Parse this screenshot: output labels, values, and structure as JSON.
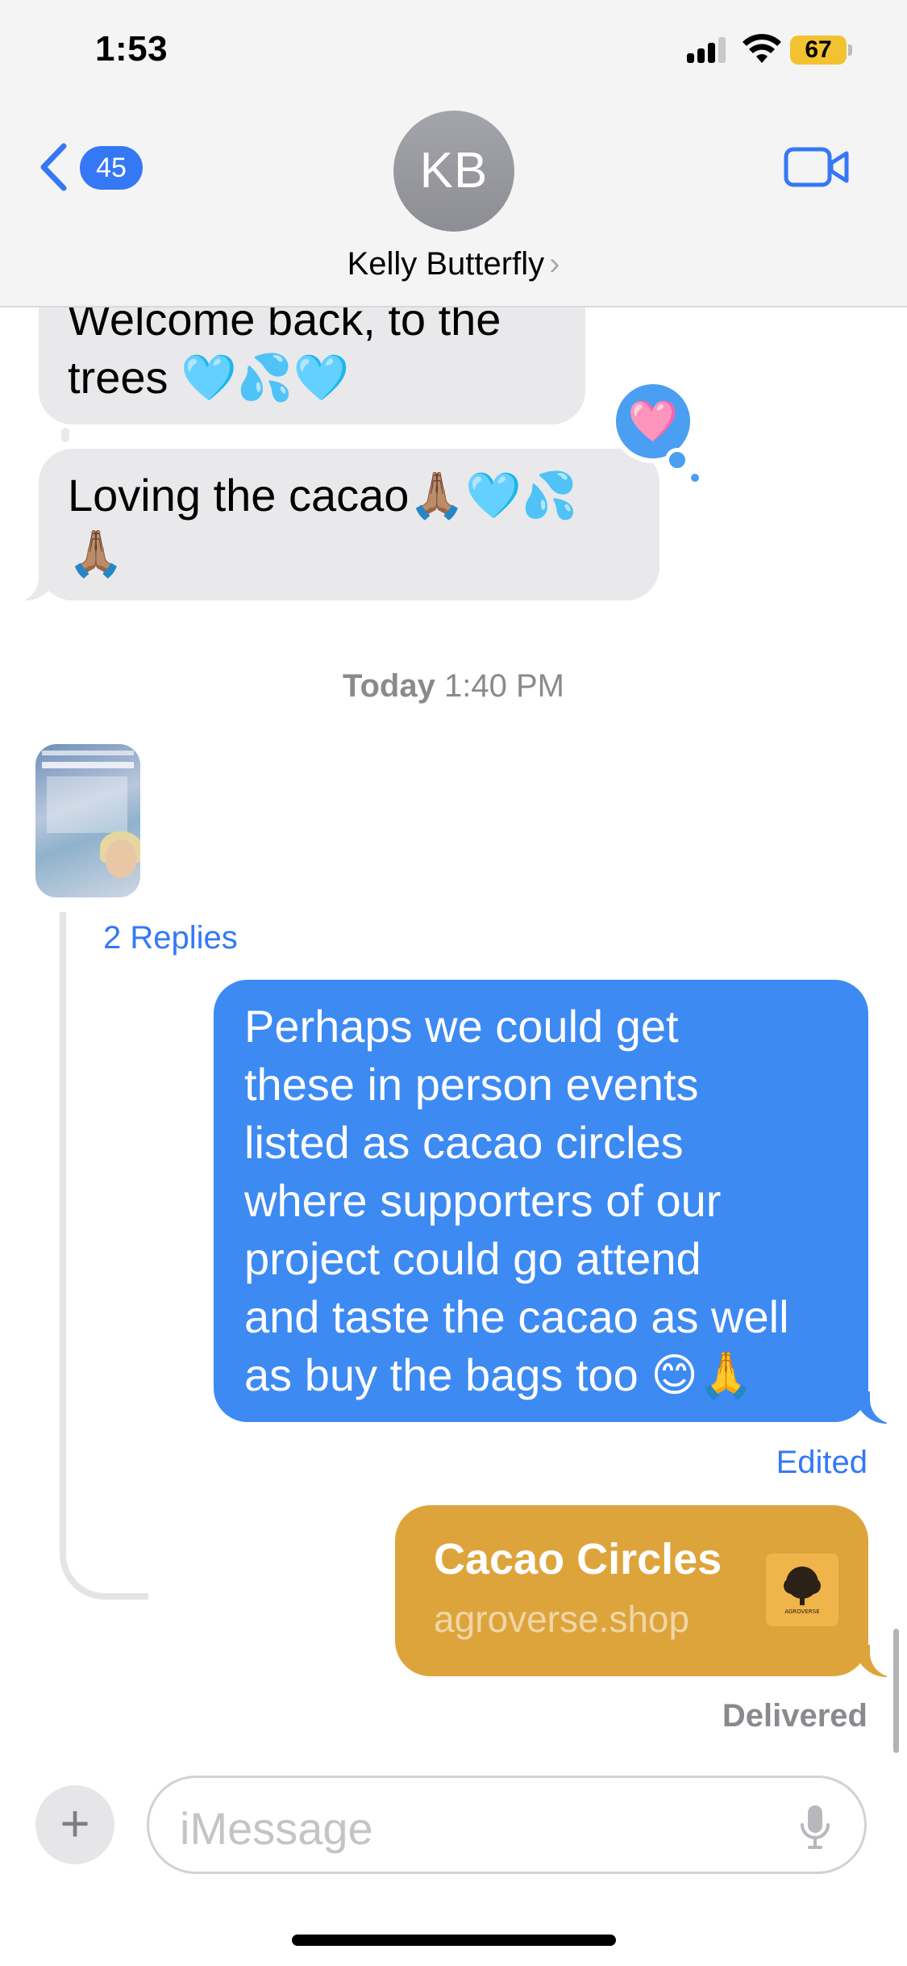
{
  "status_bar": {
    "time": "1:53",
    "battery": "67"
  },
  "header": {
    "back_count": "45",
    "avatar_initials": "KB",
    "contact_name": "Kelly Butterfly",
    "name_chevron": "›"
  },
  "messages": {
    "msg1": {
      "line1": "Welcome back, to the",
      "line2": "trees 🩵💦🩵"
    },
    "msg2": {
      "line1": "Loving the cacao🙏🏽🩵💦",
      "line2": "🙏🏽",
      "tapback": "🩷"
    },
    "timestamp": {
      "day": "Today",
      "time": "1:40 PM"
    },
    "replies_label": "2 Replies",
    "outgoing": [
      "Perhaps we could get",
      "these in person events",
      "listed as cacao circles",
      "where supporters of our",
      "project could go attend",
      "and taste the cacao as well",
      "as buy the bags too 😊🙏"
    ],
    "edited_label": "Edited",
    "link_preview": {
      "title": "Cacao Circles",
      "url": "agroverse.shop",
      "thumb_text": "AGROVERSE"
    },
    "delivered_label": "Delivered"
  },
  "composer": {
    "placeholder": "iMessage",
    "plus": "+"
  },
  "colors": {
    "accent": "#3478f6",
    "outgoing_bubble": "#3d8af3",
    "incoming_bubble": "#e9e9eb",
    "link_card": "#dea43c",
    "battery": "#f2c231"
  },
  "icons": [
    "back-chevron-icon",
    "video-call-icon",
    "signal-icon",
    "wifi-icon",
    "battery-icon",
    "plus-icon",
    "microphone-icon"
  ]
}
